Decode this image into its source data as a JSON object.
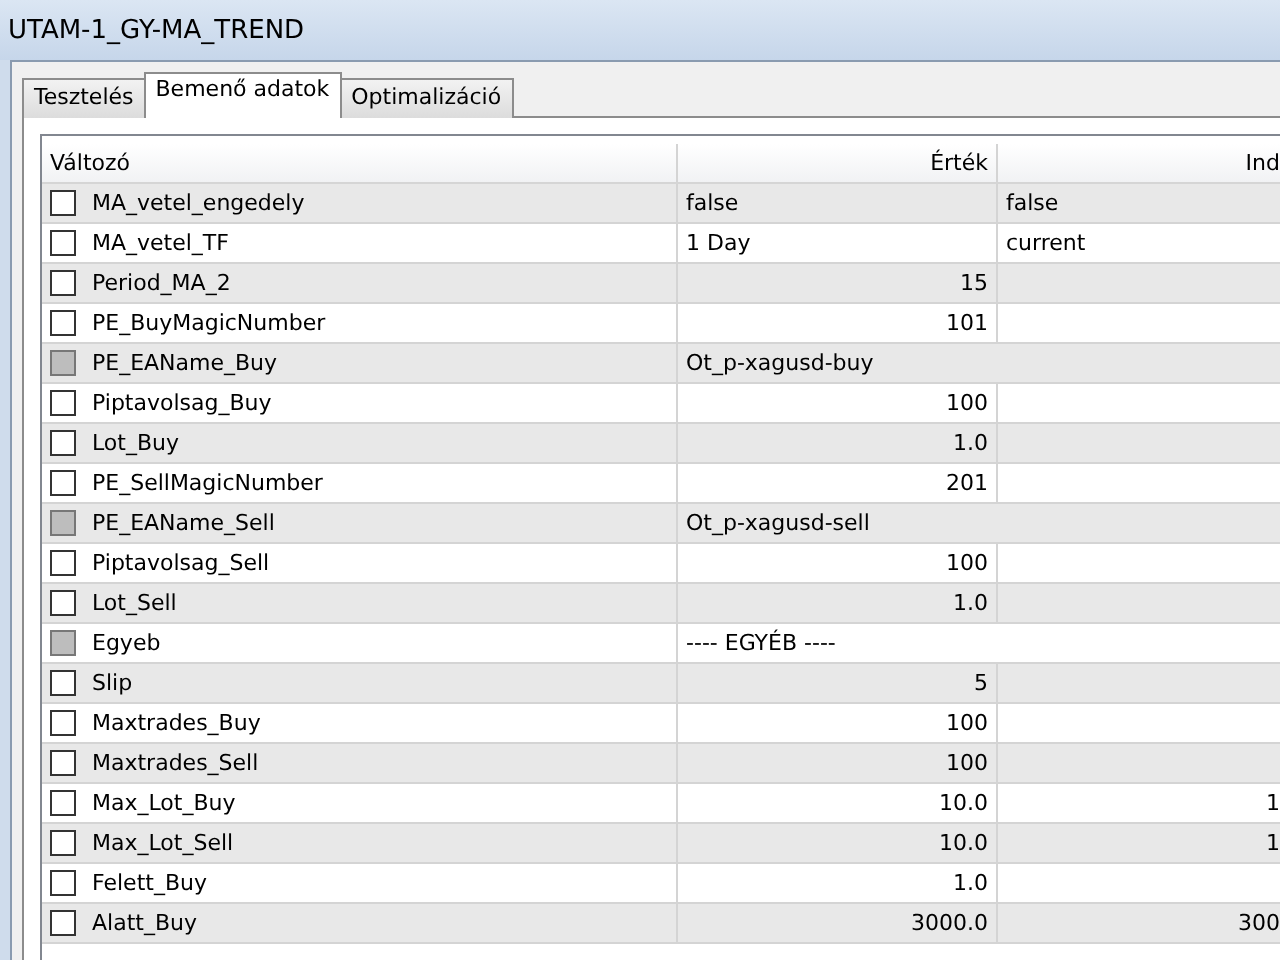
{
  "window": {
    "title": "UTAM-1_GY-MA_TREND"
  },
  "tabs": [
    {
      "label": "Tesztelés",
      "selected": false
    },
    {
      "label": "Bemenő adatok",
      "selected": true
    },
    {
      "label": "Optimalizáció",
      "selected": false
    }
  ],
  "table": {
    "columns": [
      "Változó",
      "Érték",
      "Ind"
    ],
    "rows": [
      {
        "name": "MA_vetel_engedely",
        "kind": "text",
        "checked": false,
        "disabled": false,
        "value": "false",
        "column_3": "false"
      },
      {
        "name": "MA_vetel_TF",
        "kind": "text",
        "checked": false,
        "disabled": false,
        "value": "1 Day",
        "column_3": "current"
      },
      {
        "name": "Period_MA_2",
        "kind": "number",
        "checked": false,
        "disabled": false,
        "value": "15"
      },
      {
        "name": "PE_BuyMagicNumber",
        "kind": "number",
        "checked": false,
        "disabled": false,
        "value": "101"
      },
      {
        "name": "PE_EAName_Buy",
        "kind": "string",
        "checked": false,
        "disabled": true,
        "value": "Ot_p-xagusd-buy"
      },
      {
        "name": "Piptavolsag_Buy",
        "kind": "number",
        "checked": false,
        "disabled": false,
        "value": "100"
      },
      {
        "name": "Lot_Buy",
        "kind": "number",
        "checked": false,
        "disabled": false,
        "value": "1.0"
      },
      {
        "name": "PE_SellMagicNumber",
        "kind": "number",
        "checked": false,
        "disabled": false,
        "value": "201"
      },
      {
        "name": "PE_EAName_Sell",
        "kind": "string",
        "checked": false,
        "disabled": true,
        "value": "Ot_p-xagusd-sell"
      },
      {
        "name": "Piptavolsag_Sell",
        "kind": "number",
        "checked": false,
        "disabled": false,
        "value": "100"
      },
      {
        "name": "Lot_Sell",
        "kind": "number",
        "checked": false,
        "disabled": false,
        "value": "1.0"
      },
      {
        "name": "Egyeb",
        "kind": "string",
        "checked": false,
        "disabled": true,
        "value": "---- EGYÉB ----"
      },
      {
        "name": "Slip",
        "kind": "number",
        "checked": false,
        "disabled": false,
        "value": "5"
      },
      {
        "name": "Maxtrades_Buy",
        "kind": "number",
        "checked": false,
        "disabled": false,
        "value": "100"
      },
      {
        "name": "Maxtrades_Sell",
        "kind": "number",
        "checked": false,
        "disabled": false,
        "value": "100"
      },
      {
        "name": "Max_Lot_Buy",
        "kind": "number",
        "checked": false,
        "disabled": false,
        "value": "10.0",
        "column_3": "1"
      },
      {
        "name": "Max_Lot_Sell",
        "kind": "number",
        "checked": false,
        "disabled": false,
        "value": "10.0",
        "column_3": "1"
      },
      {
        "name": "Felett_Buy",
        "kind": "number",
        "checked": false,
        "disabled": false,
        "value": "1.0"
      },
      {
        "name": "Alatt_Buy",
        "kind": "number",
        "checked": false,
        "disabled": false,
        "value": "3000.0",
        "column_3": "300"
      }
    ]
  }
}
